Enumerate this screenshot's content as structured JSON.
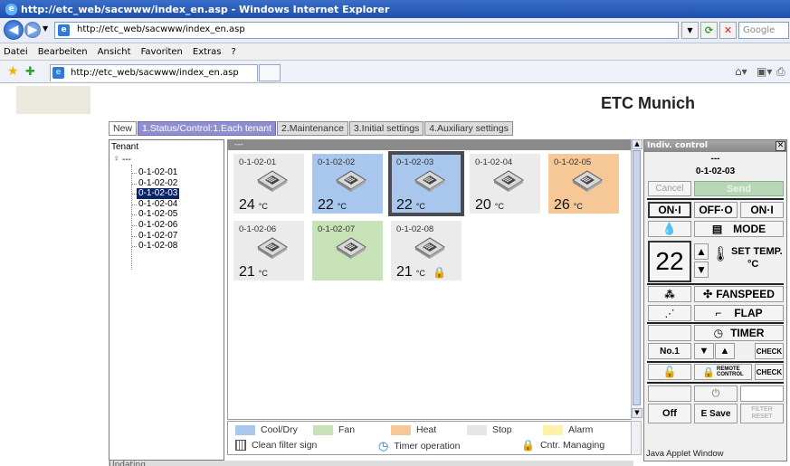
{
  "window": {
    "title": "http://etc_web/sacwww/index_en.asp - Windows Internet Explorer"
  },
  "address": {
    "url": "http://etc_web/sacwww/index_en.asp",
    "search_placeholder": "Google"
  },
  "menu": [
    "Datei",
    "Bearbeiten",
    "Ansicht",
    "Favoriten",
    "Extras",
    "?"
  ],
  "favorites": {
    "tab_label": "http://etc_web/sacwww/index_en.asp"
  },
  "site": {
    "title": "ETC Munich"
  },
  "tabs": [
    {
      "label": "New",
      "active": false
    },
    {
      "label": "1.Status/Control:1.Each tenant",
      "active": true
    },
    {
      "label": "2.Maintenance",
      "active": false
    },
    {
      "label": "3.Initial settings",
      "active": false
    },
    {
      "label": "4.Auxiliary settings",
      "active": false
    }
  ],
  "tenant_panel": {
    "title": "Tenant",
    "root": "---",
    "items": [
      "0-1-02-01",
      "0-1-02-02",
      "0-1-02-03",
      "0-1-02-04",
      "0-1-02-05",
      "0-1-02-06",
      "0-1-02-07",
      "0-1-02-08"
    ],
    "selected": "0-1-02-03"
  },
  "grid": {
    "header": "---",
    "units": [
      {
        "name": "0-1-02-01",
        "temp": "24",
        "unit": "°C",
        "mode": "stop",
        "color": "#ebebeb",
        "selected": false,
        "locked": false
      },
      {
        "name": "0-1-02-02",
        "temp": "22",
        "unit": "°C",
        "mode": "cool",
        "color": "#a9c6ec",
        "selected": false,
        "locked": false
      },
      {
        "name": "0-1-02-03",
        "temp": "22",
        "unit": "°C",
        "mode": "cool",
        "color": "#a9c6ec",
        "selected": true,
        "locked": false
      },
      {
        "name": "0-1-02-04",
        "temp": "20",
        "unit": "°C",
        "mode": "stop",
        "color": "#ebebeb",
        "selected": false,
        "locked": false
      },
      {
        "name": "0-1-02-05",
        "temp": "26",
        "unit": "°C",
        "mode": "heat",
        "color": "#f6c898",
        "selected": false,
        "locked": false
      },
      {
        "name": "0-1-02-06",
        "temp": "21",
        "unit": "°C",
        "mode": "stop",
        "color": "#ebebeb",
        "selected": false,
        "locked": false
      },
      {
        "name": "0-1-02-07",
        "temp": "",
        "unit": "",
        "mode": "fan",
        "color": "#c8e2b8",
        "selected": false,
        "locked": false
      },
      {
        "name": "0-1-02-08",
        "temp": "21",
        "unit": "°C",
        "mode": "stop",
        "color": "#ebebeb",
        "selected": false,
        "locked": true
      }
    ]
  },
  "legend": {
    "cool": "Cool/Dry",
    "fan": "Fan",
    "heat": "Heat",
    "stop": "Stop",
    "alarm": "Alarm",
    "filter": "Clean filter sign",
    "timer": "Timer operation",
    "managing": "Cntr. Managing",
    "colors": {
      "cool": "#a9c6ec",
      "fan": "#c8e2b8",
      "heat": "#f6c898",
      "stop": "#e6e6e6",
      "alarm": "#fff2a8"
    }
  },
  "status_text": "Updating",
  "applet": {
    "title": "Indiv. control",
    "header": "---",
    "selected_unit": "0-1-02-03",
    "cancel": "Cancel",
    "send": "Send",
    "on1": "ON·I",
    "off": "OFF·O",
    "on2": "ON·I",
    "mode": "MODE",
    "set_temp_value": "22",
    "set_temp_label": "SET TEMP.",
    "set_temp_unit": "°C",
    "fanspeed": "FANSPEED",
    "flap": "FLAP",
    "timer": "TIMER",
    "no1": "No.1",
    "check": "CHECK",
    "remote": "REMOTE",
    "control": "CONTROL",
    "off_btn": "Off",
    "esave": "E Save",
    "filter": "FILTER",
    "reset": "RESET",
    "footer": "Java Applet Window"
  }
}
